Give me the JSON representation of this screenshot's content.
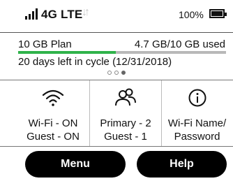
{
  "status": {
    "network": "4G LTE",
    "arrows": "↓↑",
    "battery_percent": "100%",
    "battery_level": 1.0,
    "signal_bars": 4
  },
  "plan": {
    "name": "10 GB Plan",
    "usage": "4.7 GB/10 GB used",
    "used_fraction": 0.47,
    "cycle": "20 days left in cycle (12/31/2018)",
    "page_count": 3,
    "active_page": 3
  },
  "tiles": [
    {
      "icon": "wifi-icon",
      "line1": "Wi-Fi - ON",
      "line2": "Guest - ON"
    },
    {
      "icon": "users-icon",
      "line1": "Primary - 2",
      "line2": "Guest - 1"
    },
    {
      "icon": "info-icon",
      "line1": "Wi-Fi Name/",
      "line2": "Password"
    }
  ],
  "buttons": {
    "menu": "Menu",
    "help": "Help"
  },
  "colors": {
    "usage_fill": "#2fb34a",
    "usage_track": "#b8b8b8",
    "button_bg": "#000000"
  }
}
